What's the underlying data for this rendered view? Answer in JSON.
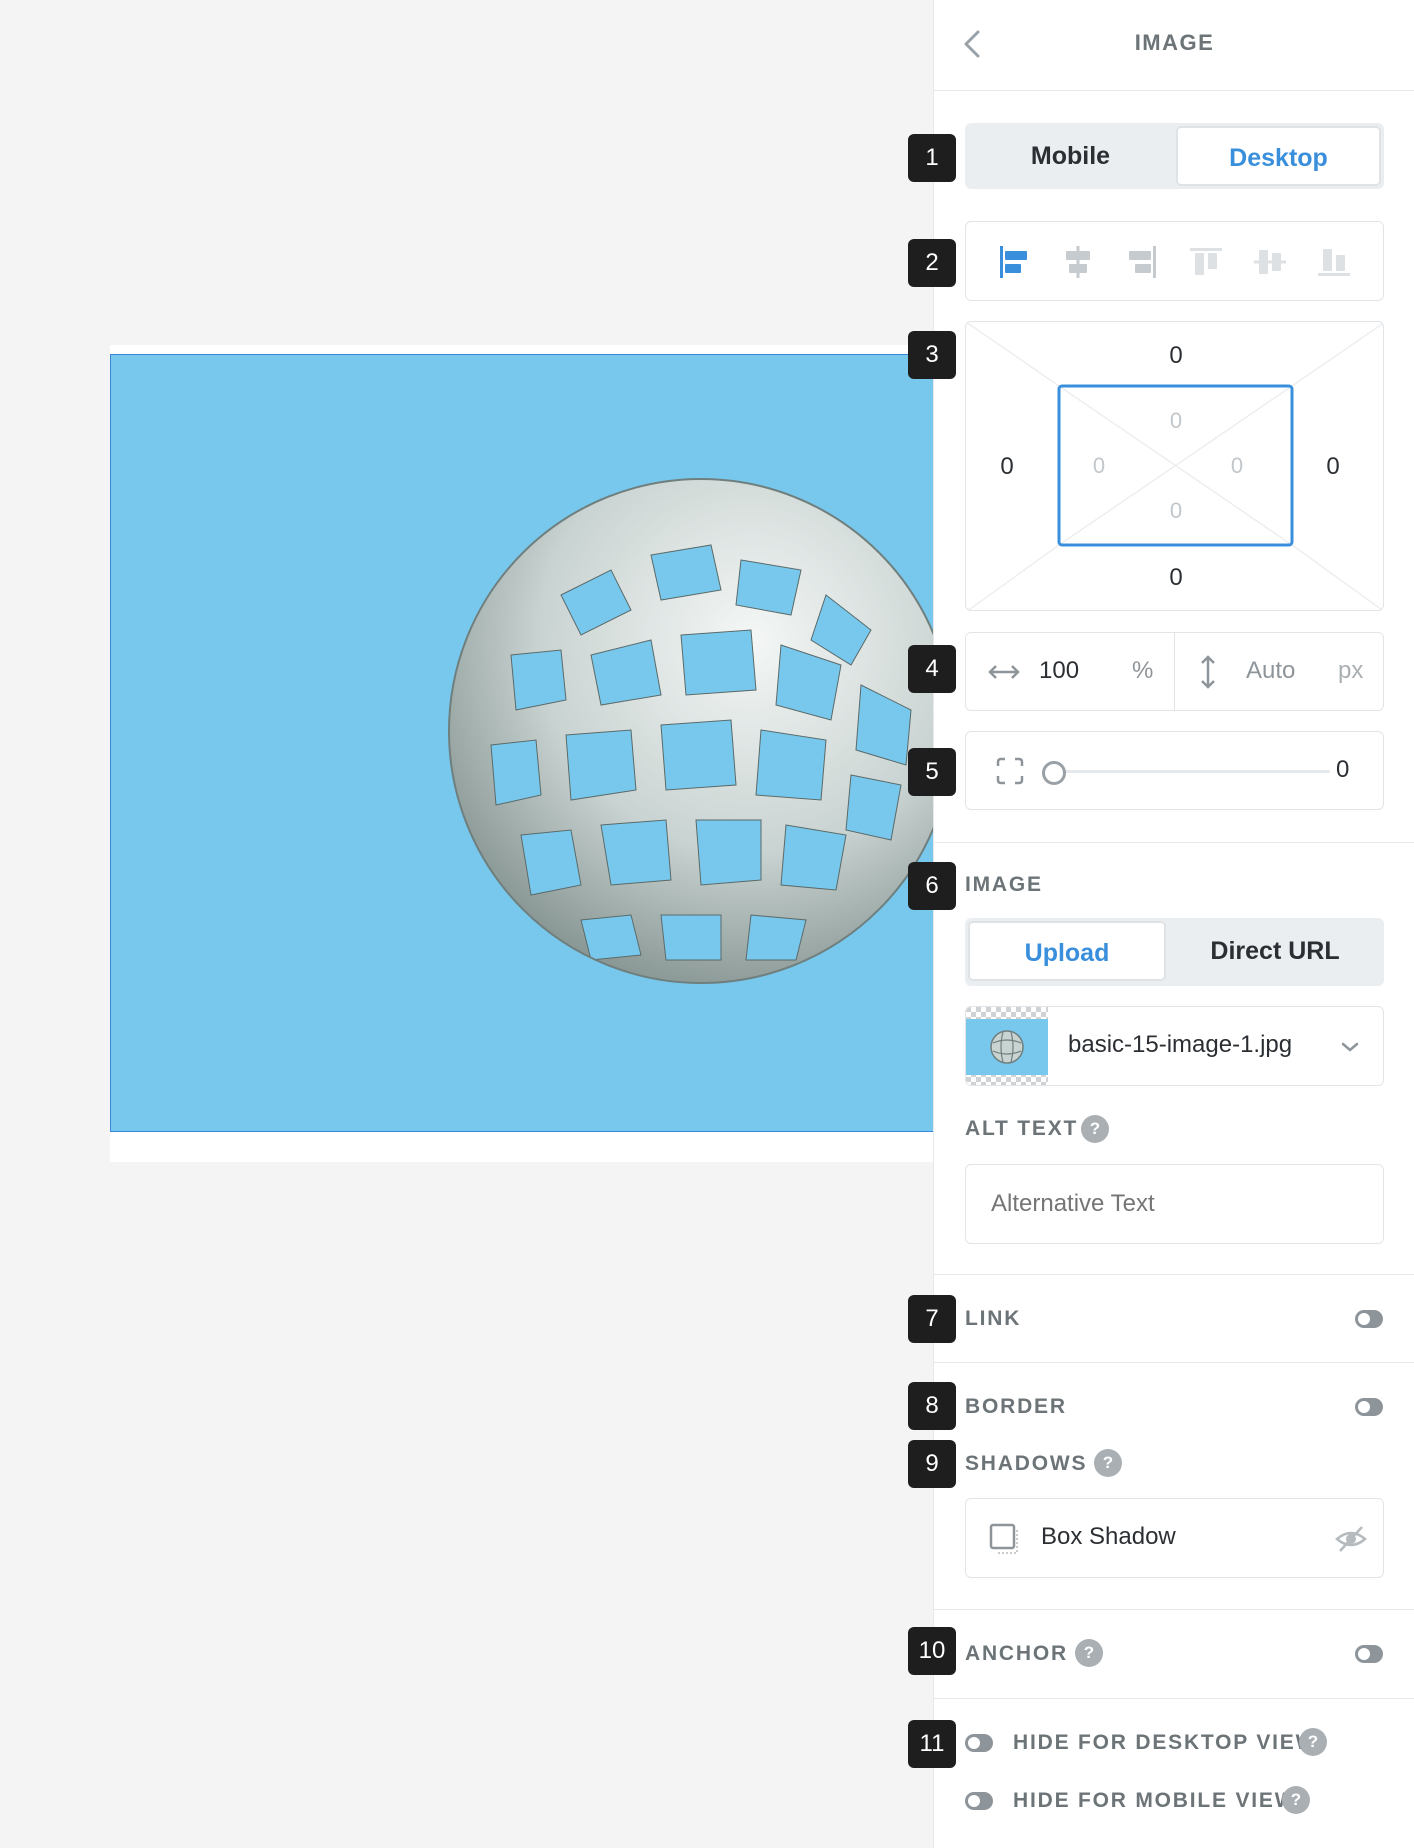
{
  "panel": {
    "title": "IMAGE",
    "device_tabs": {
      "mobile": "Mobile",
      "desktop": "Desktop",
      "active": "Desktop"
    },
    "padding": {
      "outer": {
        "top": "0",
        "right": "0",
        "bottom": "0",
        "left": "0"
      },
      "inner": {
        "top": "0",
        "right": "0",
        "bottom": "0",
        "left": "0"
      }
    },
    "size": {
      "width_value": "100",
      "width_unit": "%",
      "height_value": "Auto",
      "height_unit": "px"
    },
    "radius": {
      "value": "0",
      "slider_level": 0
    },
    "image_section": {
      "label": "IMAGE",
      "tabs": {
        "upload": "Upload",
        "direct_url": "Direct URL",
        "active": "Upload"
      },
      "file_name": "basic-15-image-1.jpg",
      "alt_text_label": "ALT TEXT",
      "alt_text_placeholder": "Alternative Text",
      "help_glyph": "?"
    },
    "link_label": "LINK",
    "border_label": "BORDER",
    "shadows_label": "SHADOWS",
    "box_shadow_label": "Box Shadow",
    "anchor_label": "ANCHOR",
    "hide_desktop_label": "HIDE FOR DESKTOP VIEW",
    "hide_mobile_label": "HIDE FOR MOBILE VIEW"
  },
  "badges": [
    "1",
    "2",
    "3",
    "4",
    "5",
    "6",
    "7",
    "8",
    "9",
    "10",
    "11"
  ],
  "colors": {
    "accent": "#3a8fdc",
    "image_bg": "#78c8ee",
    "badge_bg": "#1e1e1e",
    "muted": "#6c7478"
  },
  "icons": [
    "chevron-left-icon",
    "align-left-icon",
    "align-center-icon",
    "align-right-icon",
    "align-top-icon",
    "align-middle-icon",
    "align-bottom-icon",
    "width-arrows-icon",
    "height-arrows-icon",
    "corner-radius-icon",
    "chevron-down-icon",
    "box-shadow-icon",
    "eye-off-icon",
    "help-icon"
  ]
}
